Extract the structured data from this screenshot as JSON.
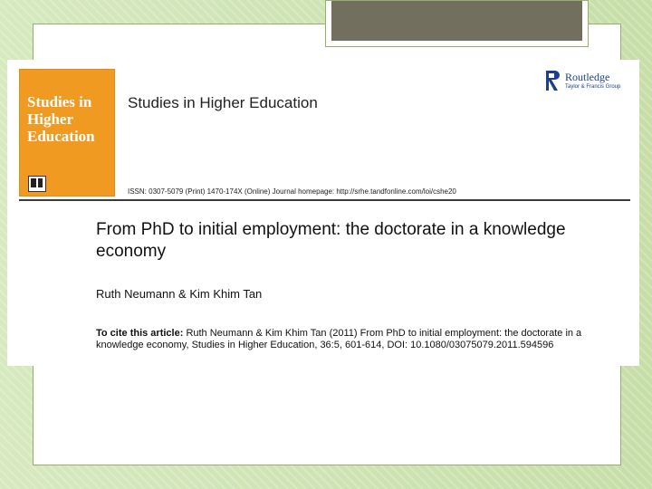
{
  "journal": {
    "cover_title": "Studies in Higher Education",
    "name": "Studies in Higher Education",
    "issn_line": "ISSN: 0307-5079 (Print) 1470-174X (Online) Journal homepage: http://srhe.tandfonline.com/loi/cshe20"
  },
  "publisher": {
    "name": "Routledge",
    "group": "Taylor & Francis Group"
  },
  "article": {
    "title": "From PhD to initial employment: the doctorate in a knowledge economy",
    "authors": "Ruth Neumann & Kim Khim Tan",
    "cite_lead": "To cite this article:",
    "cite_text": "Ruth Neumann & Kim Khim Tan (2011) From PhD to initial employment: the doctorate in a knowledge economy, Studies in Higher Education, 36:5, 601-614, DOI: 10.1080/03075079.2011.594596"
  },
  "colors": {
    "cover": "#f09a21",
    "title_bar": "#736f5f",
    "routledge": "#1b3f8e",
    "background": "#cfe3b4"
  }
}
